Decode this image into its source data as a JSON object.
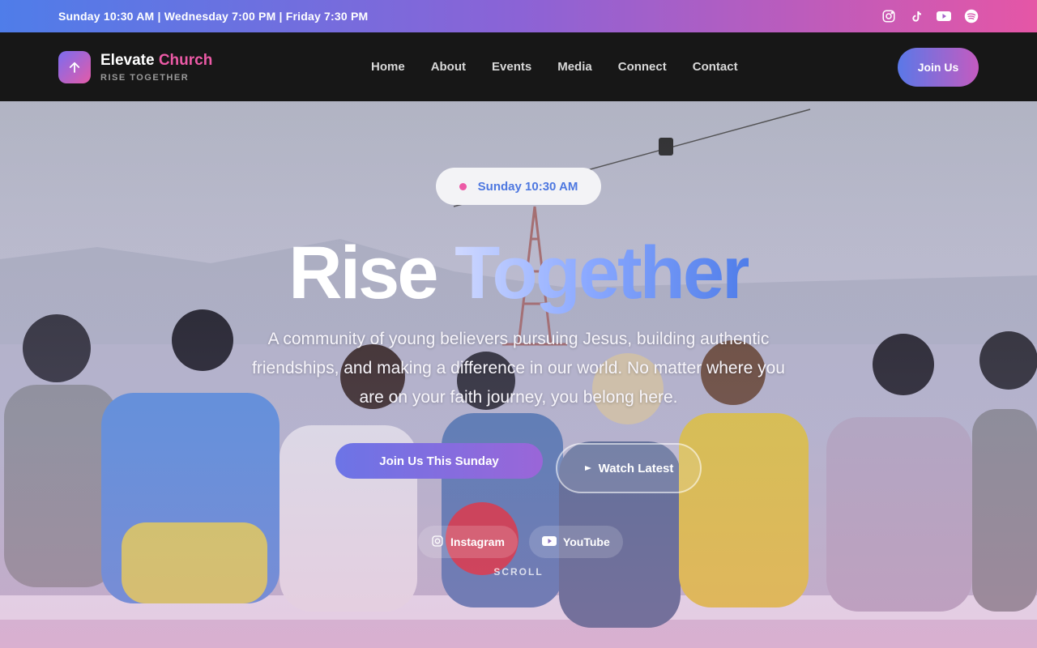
{
  "topbar": {
    "service_times": "Sunday 10:30 AM | Wednesday 7:00 PM | Friday 7:30 PM",
    "social": [
      "instagram-icon",
      "tiktok-icon",
      "youtube-icon",
      "spotify-icon"
    ]
  },
  "brand": {
    "name_first": "Elevate",
    "name_accent": "Church",
    "tagline": "RISE TOGETHER",
    "logo_icon": "arrow-up-icon"
  },
  "nav": {
    "items": [
      "Home",
      "About",
      "Events",
      "Media",
      "Connect",
      "Contact"
    ],
    "join_label": "Join Us"
  },
  "hero": {
    "badge": "Sunday 10:30 AM",
    "headline_1": "Rise",
    "headline_2": "Together",
    "description": "A community of young believers pursuing Jesus, building authentic friendships, and making a difference in our world. No matter where you are on your faith journey, you belong here.",
    "cta_primary": "Join Us This Sunday",
    "cta_secondary": "Watch Latest",
    "social_links": [
      "Instagram",
      "YouTube"
    ],
    "scroll": "SCROLL"
  },
  "colors": {
    "accent_blue": "#4f7de9",
    "accent_pink": "#ec5aa6",
    "accent_purple": "#8b63d6"
  }
}
